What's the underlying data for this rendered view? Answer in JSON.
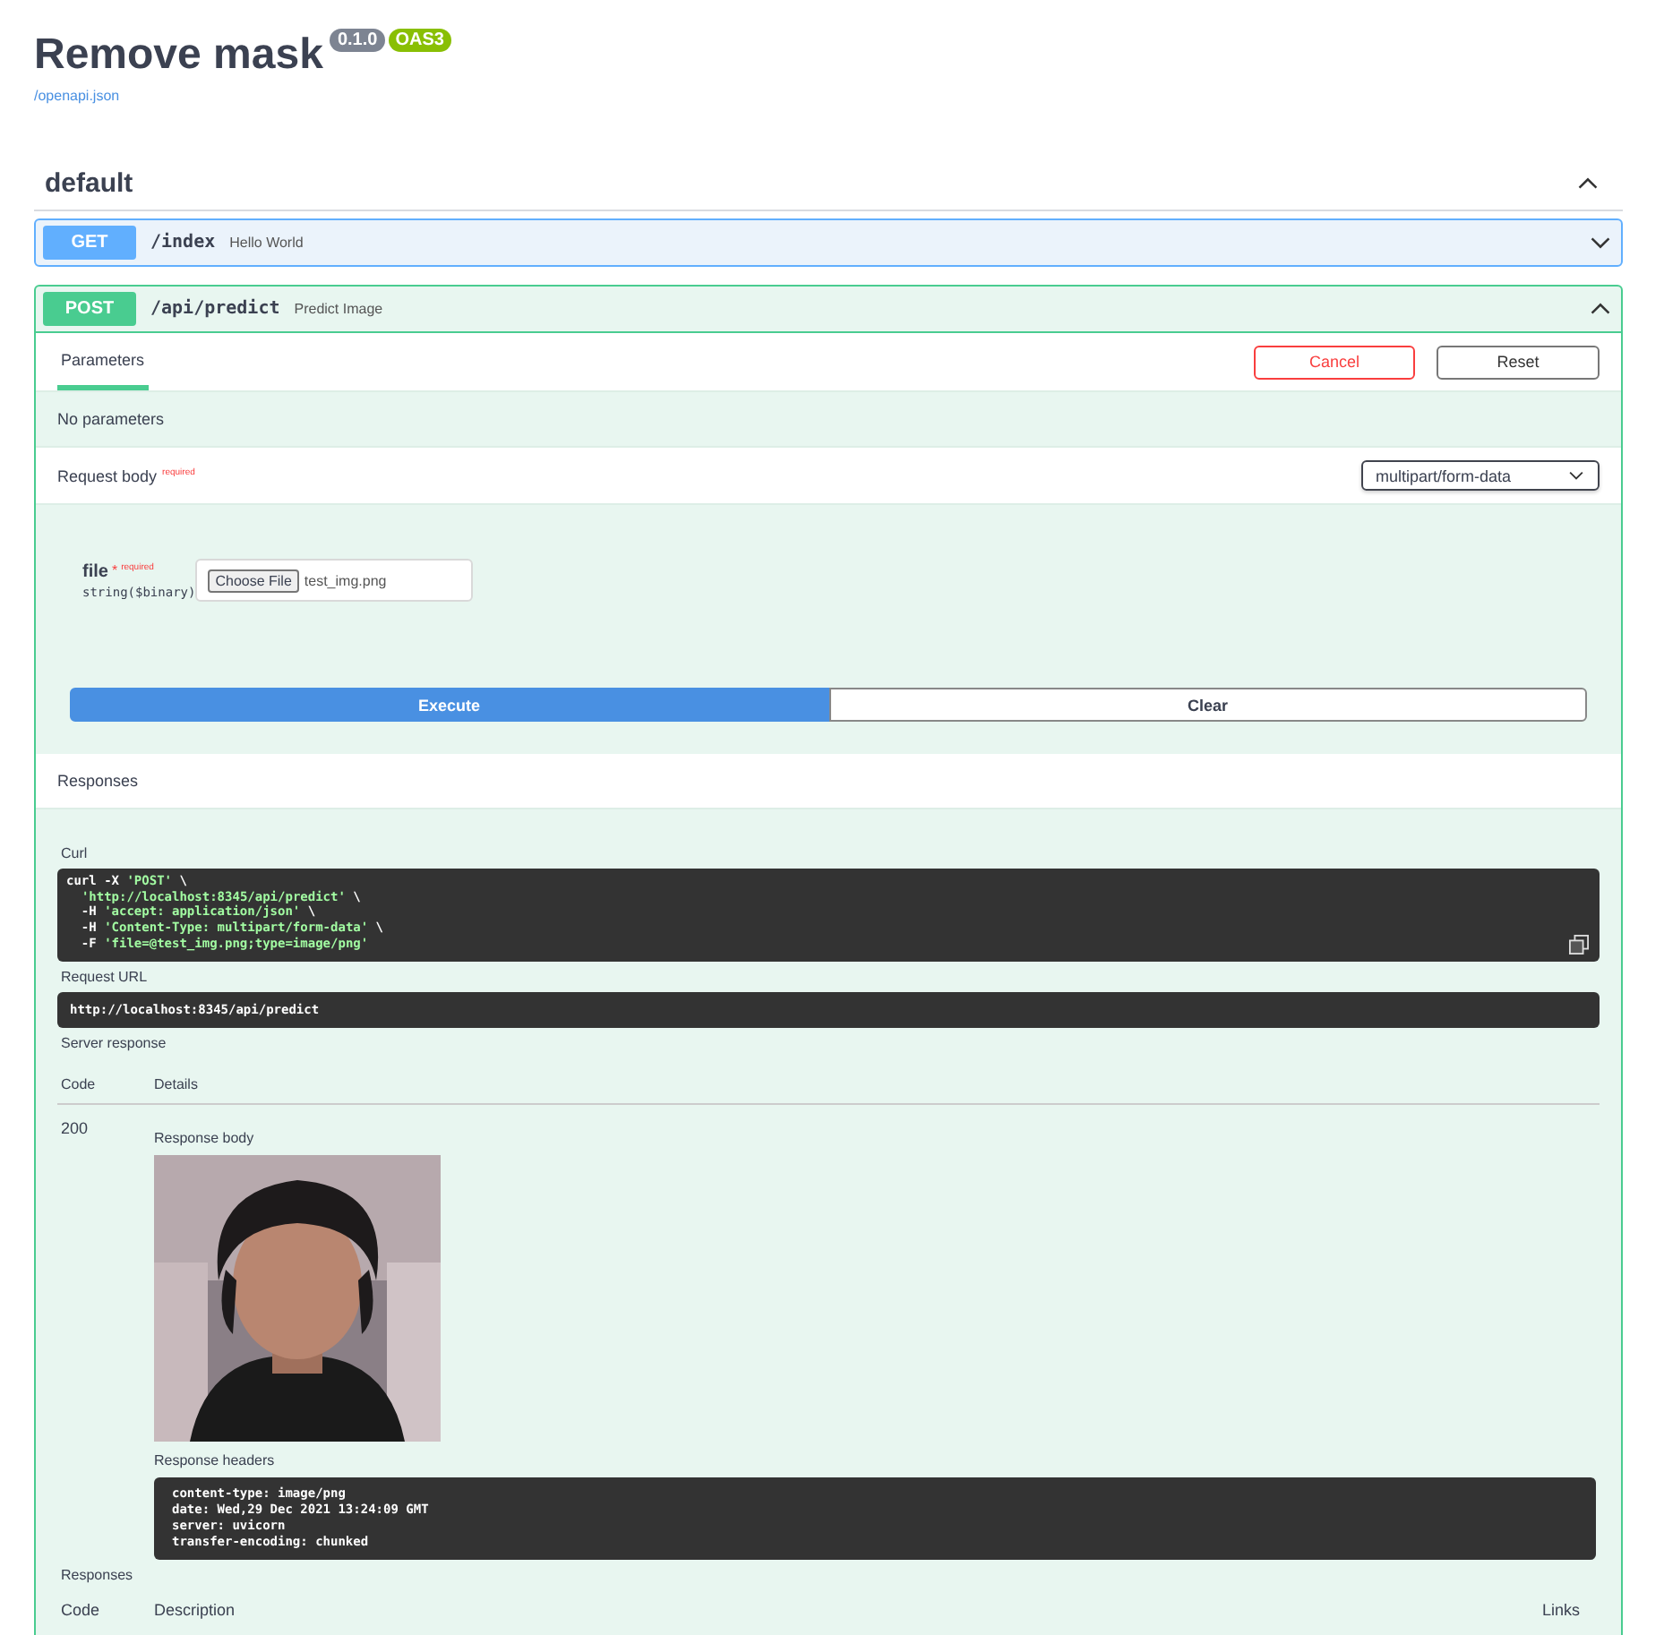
{
  "header": {
    "title": "Remove mask",
    "version": "0.1.0",
    "spec": "OAS3",
    "link": "/openapi.json"
  },
  "section": {
    "name": "default",
    "expanded": true
  },
  "operations": [
    {
      "method": "GET",
      "path": "/index",
      "summary": "Hello World",
      "expanded": false
    },
    {
      "method": "POST",
      "path": "/api/predict",
      "summary": "Predict Image",
      "expanded": true
    }
  ],
  "detail": {
    "tabs": [
      {
        "label": "Parameters",
        "selected": true
      }
    ],
    "cancel": "Cancel",
    "reset": "Reset",
    "no_params": "No parameters",
    "request_body": {
      "label": "Request body",
      "required": "required",
      "content_type": "multipart/form-data"
    },
    "field": {
      "name": "file",
      "star": "*",
      "required": "required",
      "type": "string($binary)",
      "button": "Choose File",
      "value": "test_img.png"
    },
    "execute": "Execute",
    "clear": "Clear",
    "responses_title": "Responses",
    "curl_label": "Curl",
    "curl": [
      "curl -X 'POST' \\",
      "  'http://localhost:8345/api/predict' \\",
      "  -H 'accept: application/json' \\",
      "  -H 'Content-Type: multipart/form-data' \\",
      "  -F 'file=@test_img.png;type=image/png'"
    ],
    "request_url_label": "Request URL",
    "request_url": "http://localhost:8345/api/predict",
    "server_response_label": "Server response",
    "columns": [
      "Code",
      "Details"
    ],
    "result": {
      "code": "200",
      "body_label": "Response body",
      "headers_label": "Response headers",
      "headers": [
        "content-type: image/png",
        "date: Wed,29 Dec 2021 13:24:09 GMT",
        "server: uvicorn",
        "transfer-encoding: chunked"
      ]
    },
    "responses_label": "Responses",
    "columns2": [
      "Code",
      "Description",
      "Links"
    ]
  }
}
